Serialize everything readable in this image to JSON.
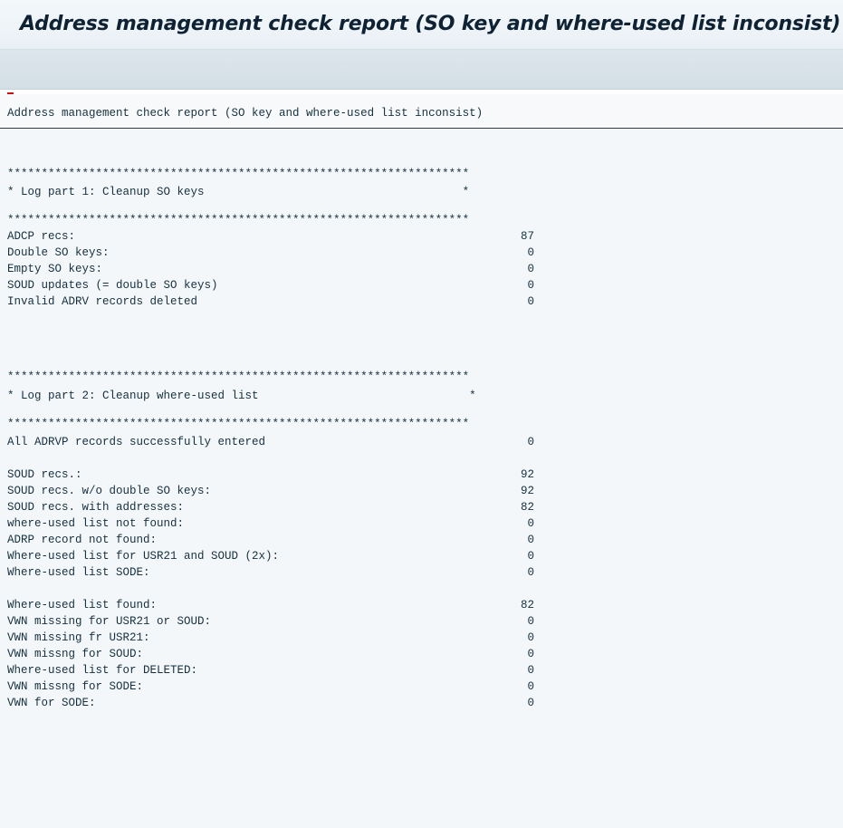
{
  "window_title": "Address management check report (SO key and where-used list inconsist)",
  "report_header": "Address management check report (SO key and where-used list inconsist)",
  "part1": {
    "stars": "********************************************************************",
    "heading": "* Log part 1: Cleanup SO keys                                      *",
    "rows": [
      {
        "label": "ADCP recs:",
        "value": "87"
      },
      {
        "label": "Double SO keys:",
        "value": "0"
      },
      {
        "label": "Empty SO keys:",
        "value": "0"
      },
      {
        "label": "SOUD updates (= double SO keys)",
        "value": "0"
      },
      {
        "label": "Invalid ADRV records deleted",
        "value": "0"
      }
    ]
  },
  "part2": {
    "stars": "********************************************************************",
    "heading": "* Log part 2: Cleanup where-used list                               *",
    "entered": {
      "label": "All ADRVP records successfully entered",
      "value": "0"
    },
    "group1": [
      {
        "label": "SOUD recs.:",
        "value": "92"
      },
      {
        "label": "SOUD recs. w/o double SO keys:",
        "value": "92"
      },
      {
        "label": "SOUD recs. with addresses:",
        "value": "82"
      },
      {
        "label": "where-used list not found:",
        "value": "0"
      },
      {
        "label": "ADRP record not found:",
        "value": "0"
      },
      {
        "label": "Where-used list for USR21 and SOUD (2x):",
        "value": "0"
      },
      {
        "label": "Where-used list SODE:",
        "value": "0"
      }
    ],
    "group2": [
      {
        "label": "Where-used list found:",
        "value": "82"
      },
      {
        "label": "VWN missing for USR21 or SOUD:",
        "value": "0"
      },
      {
        "label": "VWN missing fr USR21:",
        "value": "0"
      },
      {
        "label": "VWN missng for SOUD:",
        "value": "0"
      },
      {
        "label": "Where-used list for DELETED:",
        "value": "0"
      },
      {
        "label": "VWN missng for SODE:",
        "value": "0"
      },
      {
        "label": "VWN for SODE:",
        "value": "0"
      }
    ]
  }
}
